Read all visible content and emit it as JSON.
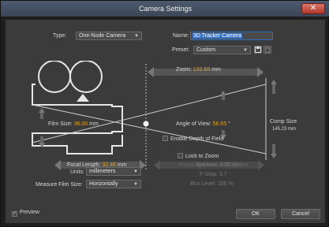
{
  "window": {
    "title": "Camera Settings",
    "close_glyph": "✕"
  },
  "type": {
    "label": "Type:",
    "value": "One-Node Camera"
  },
  "name": {
    "label": "Name:",
    "value": "3D Tracker Camera"
  },
  "preset": {
    "label": "Preset:",
    "value": "Custom",
    "save_icon": "save-icon",
    "delete_icon": "trash-icon"
  },
  "diagram": {
    "zoom_label": "Zoom:",
    "zoom_value": "132.88",
    "zoom_unit": "mm",
    "film_label": "Film Size:",
    "film_value": "36.00",
    "film_unit": "mm",
    "aov_label": "Angle of View:",
    "aov_value": "56.65",
    "aov_unit": "°",
    "comp_label": "Comp Size",
    "comp_value": "145.23 mm",
    "focal_label": "Focal Length:",
    "focal_value": "32.46",
    "focal_unit": "mm",
    "focus_label": "Focus Distance:",
    "focus_value": "132.88 mm"
  },
  "options": {
    "depth_of_field": "Enable Depth of Field",
    "lock_zoom": "Lock to Zoom",
    "aperture": "Aperture:  8.50 mm",
    "fstop": "F-Stop:  3.7",
    "blur": "Blur Level:  100 %"
  },
  "units": {
    "label": "Units:",
    "value": "millimeters"
  },
  "measure": {
    "label": "Measure Film Size:",
    "value": "Horizontally"
  },
  "footer": {
    "preview": "Preview",
    "ok": "OK",
    "cancel": "Cancel"
  },
  "colors": {
    "accent": "#e4a323",
    "selection": "#3874c7"
  }
}
